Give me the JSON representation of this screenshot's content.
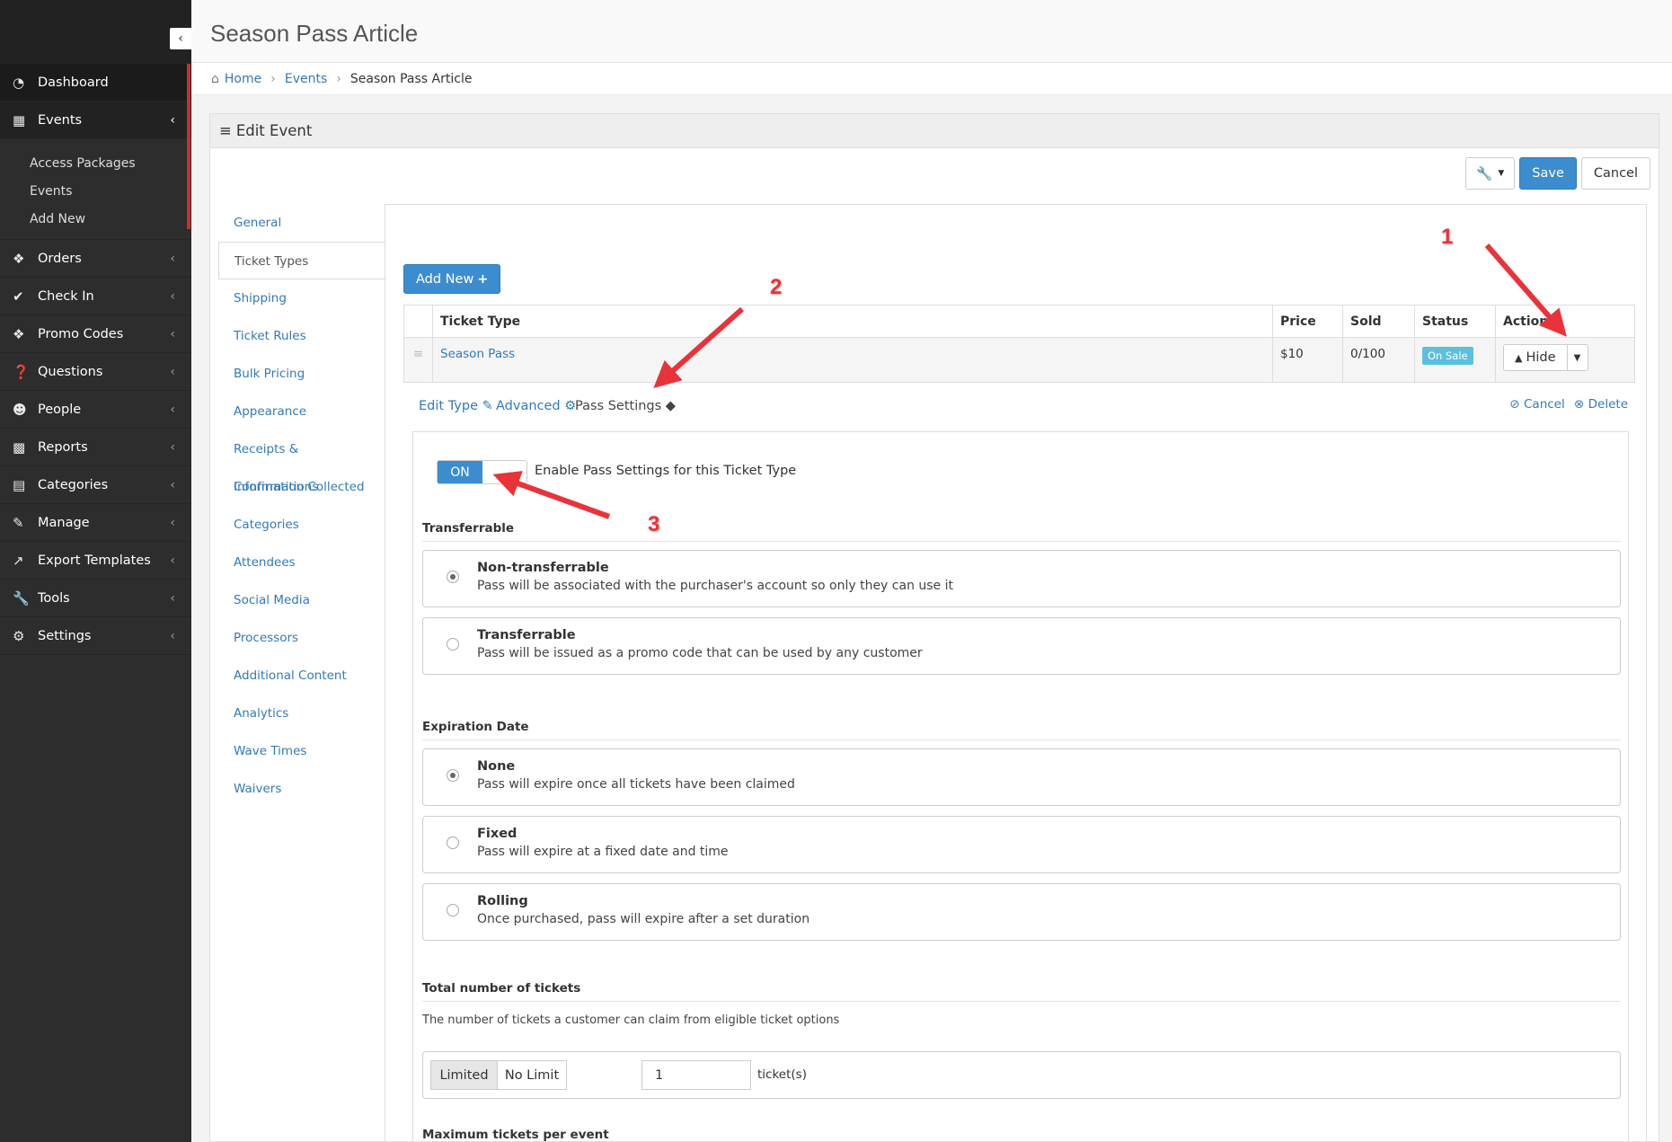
{
  "sidebar": {
    "items": [
      {
        "label": "Dashboard",
        "icon": "dashboard-icon"
      },
      {
        "label": "Events",
        "icon": "calendar-icon"
      },
      {
        "label": "Orders",
        "icon": "tag-icon"
      },
      {
        "label": "Check In",
        "icon": "check-icon"
      },
      {
        "label": "Promo Codes",
        "icon": "tags-icon"
      },
      {
        "label": "Questions",
        "icon": "question-icon"
      },
      {
        "label": "People",
        "icon": "user-icon"
      },
      {
        "label": "Reports",
        "icon": "bar-chart-icon"
      },
      {
        "label": "Categories",
        "icon": "folder-icon"
      },
      {
        "label": "Manage",
        "icon": "edit-icon"
      },
      {
        "label": "Export Templates",
        "icon": "external-link-icon"
      },
      {
        "label": "Tools",
        "icon": "wrench-icon"
      },
      {
        "label": "Settings",
        "icon": "gears-icon"
      }
    ],
    "events_sub": [
      "Access Packages",
      "Events",
      "Add New"
    ]
  },
  "header": {
    "title": "Season Pass Article"
  },
  "breadcrumb": {
    "home": "Home",
    "events": "Events",
    "current": "Season Pass Article"
  },
  "panel": {
    "title": "Edit Event"
  },
  "toolbar": {
    "save": "Save",
    "cancel": "Cancel"
  },
  "tabs": [
    "General",
    "Ticket Types",
    "Shipping",
    "Ticket Rules",
    "Bulk Pricing",
    "Appearance",
    "Receipts & Confirmations",
    "Information Collected",
    "Categories",
    "Attendees",
    "Social Media",
    "Processors",
    "Additional Content",
    "Analytics",
    "Wave Times",
    "Waivers"
  ],
  "add_new": "Add New",
  "table": {
    "headers": [
      "Ticket Type",
      "Price",
      "Sold",
      "Status",
      "Actions"
    ],
    "row": {
      "name": "Season Pass",
      "price": "$10",
      "sold": "0/100",
      "status": "On Sale",
      "action": "Hide"
    }
  },
  "subtabs": {
    "edit": "Edit Type",
    "advanced": "Advanced",
    "pass": "Pass Settings",
    "cancel": "Cancel",
    "delete": "Delete"
  },
  "pass": {
    "toggle": "ON",
    "toggle_label": "Enable Pass Settings for this Ticket Type",
    "transferrable": {
      "title": "Transferrable",
      "options": [
        {
          "title": "Non-transferrable",
          "desc": "Pass will be associated with the purchaser's account so only they can use it",
          "selected": true
        },
        {
          "title": "Transferrable",
          "desc": "Pass will be issued as a promo code that can be used by any customer",
          "selected": false
        }
      ]
    },
    "expiration": {
      "title": "Expiration Date",
      "options": [
        {
          "title": "None",
          "desc": "Pass will expire once all tickets have been claimed",
          "selected": true
        },
        {
          "title": "Fixed",
          "desc": "Pass will expire at a fixed date and time",
          "selected": false
        },
        {
          "title": "Rolling",
          "desc": "Once purchased, pass will expire after a set duration",
          "selected": false
        }
      ]
    },
    "total": {
      "title": "Total number of tickets",
      "desc": "The number of tickets a customer can claim from eligible ticket options",
      "limited": "Limited",
      "no_limit": "No Limit",
      "value": "1",
      "unit": "ticket(s)"
    },
    "max_title": "Maximum tickets per event"
  },
  "annotations": [
    "1",
    "2",
    "3"
  ],
  "colors": {
    "accent": "#3c8dd0",
    "annotation": "#e8333a",
    "link": "#337ab7"
  }
}
